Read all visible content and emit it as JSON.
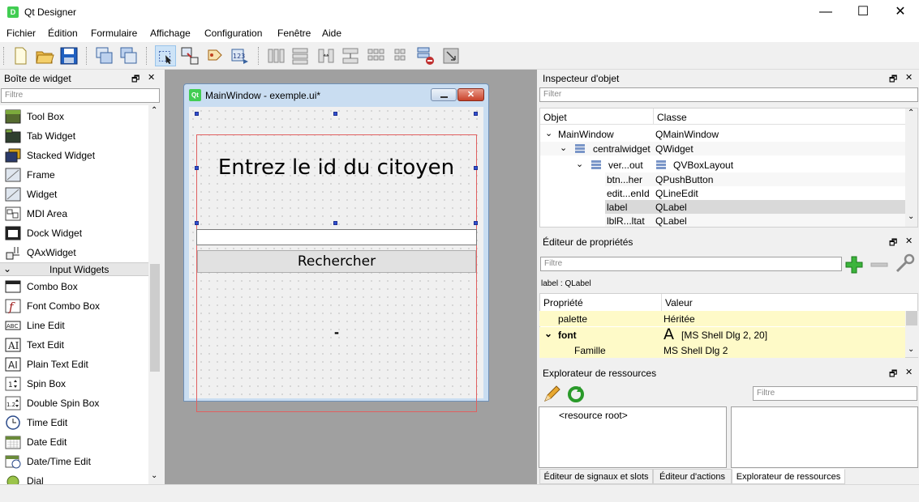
{
  "window": {
    "title": "Qt Designer",
    "icon_text": "D",
    "minimize": "—",
    "maximize": "☐",
    "close": "✕"
  },
  "menu": [
    "Fichier",
    "Édition",
    "Formulaire",
    "Affichage",
    "Configuration",
    "Fenêtre",
    "Aide"
  ],
  "widget_box": {
    "title": "Boîte de widget",
    "filter_placeholder": "Filtre",
    "items_top": [
      "Tool Box",
      "Tab Widget",
      "Stacked Widget",
      "Frame",
      "Widget",
      "MDI Area",
      "Dock Widget",
      "QAxWidget"
    ],
    "category": "Input Widgets",
    "items_bottom": [
      "Combo Box",
      "Font Combo Box",
      "Line Edit",
      "Text Edit",
      "Plain Text Edit",
      "Spin Box",
      "Double Spin Box",
      "Time Edit",
      "Date Edit",
      "Date/Time Edit",
      "Dial"
    ]
  },
  "form_window": {
    "title": "MainWindow - exemple.ui*",
    "icon_text": "Qt",
    "label_text": "Entrez le id du citoyen",
    "button_text": "Rechercher",
    "result_text": "-"
  },
  "object_inspector": {
    "title": "Inspecteur d'objet",
    "filter_placeholder": "Filter",
    "col_object": "Objet",
    "col_class": "Classe",
    "rows": [
      {
        "object": "MainWindow",
        "class": "QMainWindow"
      },
      {
        "object": "centralwidget",
        "class": "QWidget"
      },
      {
        "object": "ver...out",
        "class": "QVBoxLayout"
      },
      {
        "object": "btn...her",
        "class": "QPushButton"
      },
      {
        "object": "edit...enId",
        "class": "QLineEdit"
      },
      {
        "object": "label",
        "class": "QLabel"
      },
      {
        "object": "lblR...ltat",
        "class": "QLabel"
      }
    ]
  },
  "property_editor": {
    "title": "Éditeur de propriétés",
    "filter_placeholder": "Filtre",
    "context": "label : QLabel",
    "col_property": "Propriété",
    "col_value": "Valeur",
    "rows": [
      {
        "name": "palette",
        "value": "Héritée"
      },
      {
        "name": "font",
        "value": "[MS Shell Dlg 2, 20]"
      },
      {
        "name": "Famille",
        "value": "MS Shell Dlg 2"
      }
    ]
  },
  "resource_explorer": {
    "title": "Explorateur de ressources",
    "filter_placeholder": "Filtre",
    "root": "<resource root>"
  },
  "tabs": [
    "Éditeur de signaux et slots",
    "Éditeur d'actions",
    "Explorateur de ressources"
  ],
  "colors": {
    "accent": "#41cd52",
    "selection": "#d9d9d9",
    "property_bg": "#fefac8"
  }
}
